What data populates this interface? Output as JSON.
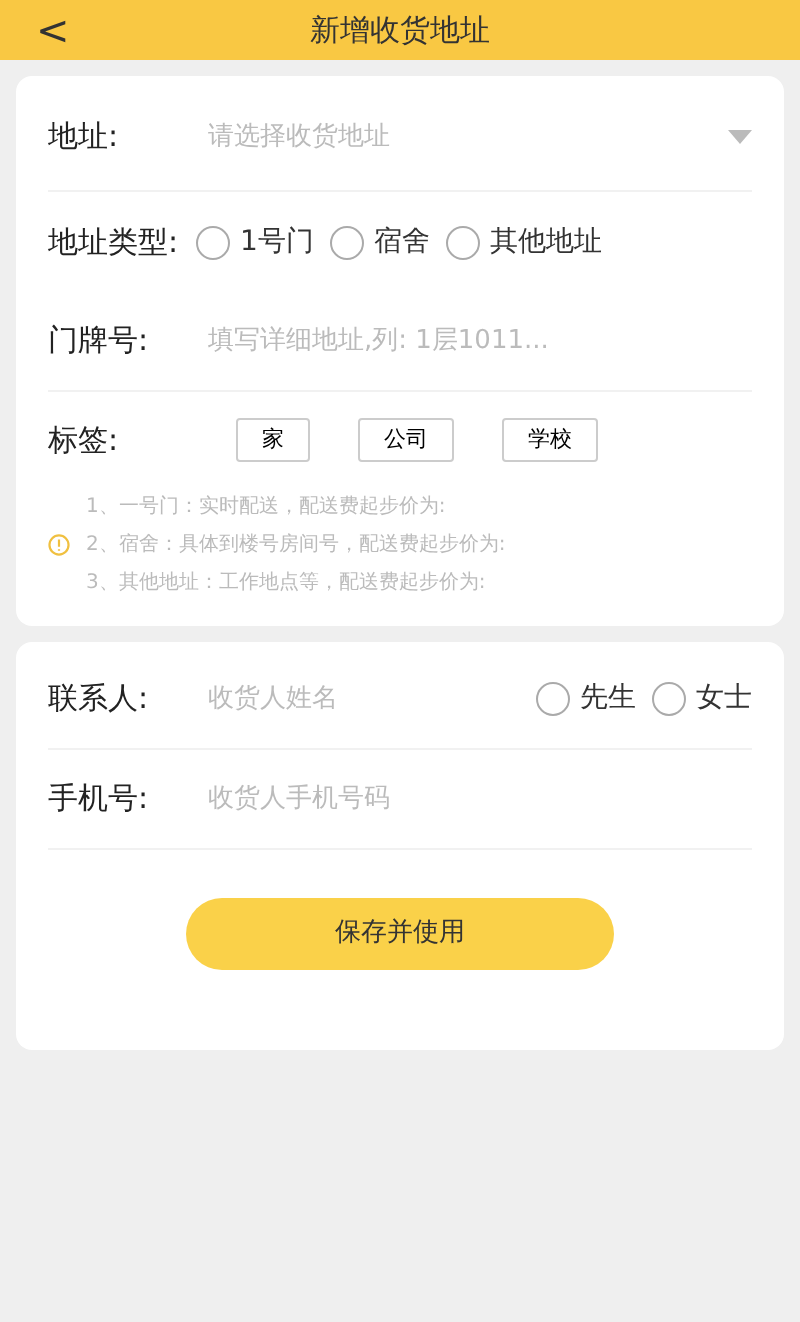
{
  "header": {
    "back": "<",
    "title": "新增收货地址"
  },
  "address": {
    "label": "地址:",
    "placeholder": "请选择收货地址"
  },
  "address_type": {
    "label": "地址类型:",
    "options": [
      {
        "label": "1号门",
        "selected": false
      },
      {
        "label": "宿舍",
        "selected": false
      },
      {
        "label": "其他地址",
        "selected": false
      }
    ]
  },
  "door": {
    "label": "门牌号:",
    "placeholder": "填写详细地址,列: 1层1011..."
  },
  "tags": {
    "label": "标签:",
    "items": [
      "家",
      "公司",
      "学校"
    ]
  },
  "notes": [
    "1、一号门：实时配送，配送费起步价为:",
    "2、宿舍：具体到楼号房间号，配送费起步价为:",
    "3、其他地址：工作地点等，配送费起步价为:"
  ],
  "contact": {
    "label": "联系人:",
    "placeholder": "收货人姓名",
    "options": [
      {
        "label": "先生",
        "selected": false
      },
      {
        "label": "女士",
        "selected": false
      }
    ]
  },
  "phone": {
    "label": "手机号:",
    "placeholder": "收货人手机号码"
  },
  "save_button": "保存并使用"
}
